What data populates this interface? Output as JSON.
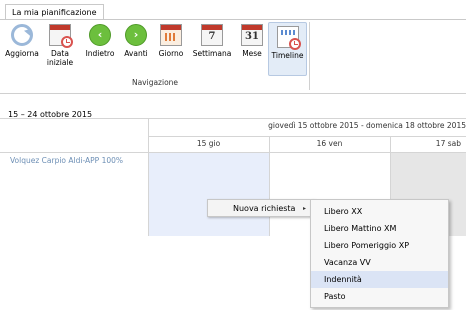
{
  "tab": {
    "label": "La mia pianificazione"
  },
  "ribbon": {
    "buttons": [
      {
        "id": "aggiorna",
        "label_lines": [
          "Aggiorna"
        ],
        "icon": "refresh-icon"
      },
      {
        "id": "data-iniziale",
        "label_lines": [
          "Data",
          "iniziale"
        ],
        "icon": "calendar-clock-icon"
      },
      {
        "id": "indietro",
        "label_lines": [
          "Indietro"
        ],
        "icon": "arrow-left-icon"
      },
      {
        "id": "avanti",
        "label_lines": [
          "Avanti"
        ],
        "icon": "arrow-right-icon"
      },
      {
        "id": "giorno",
        "label_lines": [
          "Giorno"
        ],
        "icon": "calendar-day-icon"
      },
      {
        "id": "settimana",
        "label_lines": [
          "Settimana"
        ],
        "icon": "calendar-week-icon",
        "number": "7"
      },
      {
        "id": "mese",
        "label_lines": [
          "Mese"
        ],
        "icon": "calendar-month-icon",
        "number": "31"
      },
      {
        "id": "timeline",
        "label_lines": [
          "Timeline"
        ],
        "icon": "timeline-icon",
        "selected": true
      }
    ],
    "group_label": "Navigazione"
  },
  "period": "15 – 24 ottobre 2015",
  "grid": {
    "range_header": "giovedì 15 ottobre 2015 - domenica 18 ottobre 2015",
    "days": [
      "15 gio",
      "16 ven",
      "17 sab"
    ],
    "resource": "Volquez Carpio Aldi-APP 100%"
  },
  "context_menu": {
    "item": "Nuova richiesta",
    "arrow": "▸",
    "submenu": [
      "Libero XX",
      "Libero Mattino XM",
      "Libero Pomeriggio XP",
      "Vacanza VV",
      "Indennità",
      "Pasto"
    ],
    "highlighted": "Indennità"
  },
  "colors": {
    "accent": "#6d8fb5",
    "selected_cell": "#e8eefb",
    "weekend": "#e6e6e6",
    "menu_highlight": "#dbe4f5"
  }
}
